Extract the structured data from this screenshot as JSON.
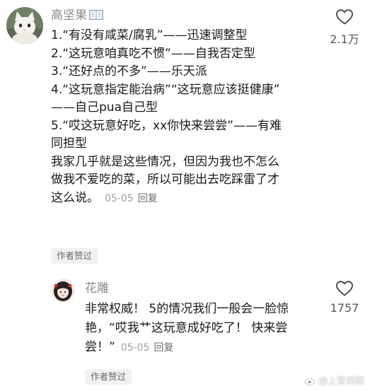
{
  "main_comment": {
    "username": "高坚果",
    "username_icon": "open-book-icon",
    "lines": [
      "1.“有没有咸菜/腐乳”——迅速调整型",
      "2.“这玩意咱真吃不惯”——自我否定型",
      "3.“还好点的不多”——乐天派",
      "4.“这玩意指定能治病”“这玩意应该挺健康”",
      "——自己pua自己型",
      "5.“哎这玩意好吃，xx你快来尝尝”——有难",
      "同担型",
      "我家几乎就是这些情况，但因为我也不怎么",
      "做我不爱吃的菜，所以可能出去吃踩雷了才",
      "这么说。"
    ],
    "date": "05-05",
    "reply_label": "回复",
    "badge": "作者赞过",
    "like_count": "2.1万"
  },
  "reply_comment": {
    "username": "花雕",
    "lines": [
      "非常权威！ 5的情况我们一般会一脸惊",
      "艳，“哎我艹这玩意成好吃了！ 快来尝",
      "尝！”"
    ],
    "date": "05-05",
    "reply_label": "回复",
    "badge": "作者赞过",
    "like_count": "1757"
  },
  "watermark": "@上官美眠",
  "colors": {
    "text": "#1a1a1a",
    "username": "#8a8a8a",
    "meta": "#a0a0a0",
    "badge_bg": "#f1f1f1"
  }
}
